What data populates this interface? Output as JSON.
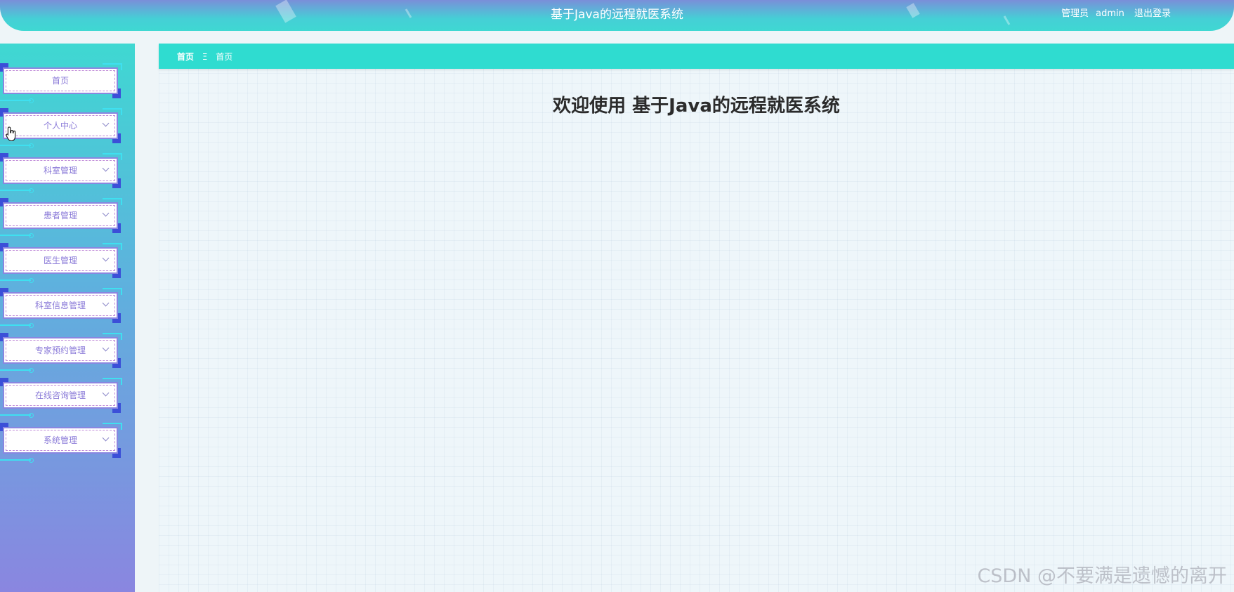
{
  "header": {
    "title": "基于Java的远程就医系统",
    "user_role": "管理员",
    "username": "admin",
    "logout_label": "退出登录"
  },
  "sidebar": {
    "items": [
      {
        "label": "首页",
        "has_submenu": false
      },
      {
        "label": "个人中心",
        "has_submenu": true
      },
      {
        "label": "科室管理",
        "has_submenu": true
      },
      {
        "label": "患者管理",
        "has_submenu": true
      },
      {
        "label": "医生管理",
        "has_submenu": true
      },
      {
        "label": "科室信息管理",
        "has_submenu": true
      },
      {
        "label": "专家预约管理",
        "has_submenu": true
      },
      {
        "label": "在线咨询管理",
        "has_submenu": true
      },
      {
        "label": "系统管理",
        "has_submenu": true
      }
    ]
  },
  "breadcrumb": {
    "home": "首页",
    "separator": "Ξ",
    "current": "首页"
  },
  "main": {
    "welcome": "欢迎使用 基于Java的远程就医系统"
  },
  "watermark": "CSDN @不要满是遗憾的离开",
  "colors": {
    "header_start": "#7a8fd9",
    "header_end": "#3fd8d2",
    "breadcrumb_bar": "#2fdcd0",
    "menu_text": "#8a7ad8",
    "menu_corner": "#3b4fd8"
  },
  "icons": {
    "cursor": "hand-pointer-icon",
    "menu_expand": "chevron-down-icon"
  }
}
